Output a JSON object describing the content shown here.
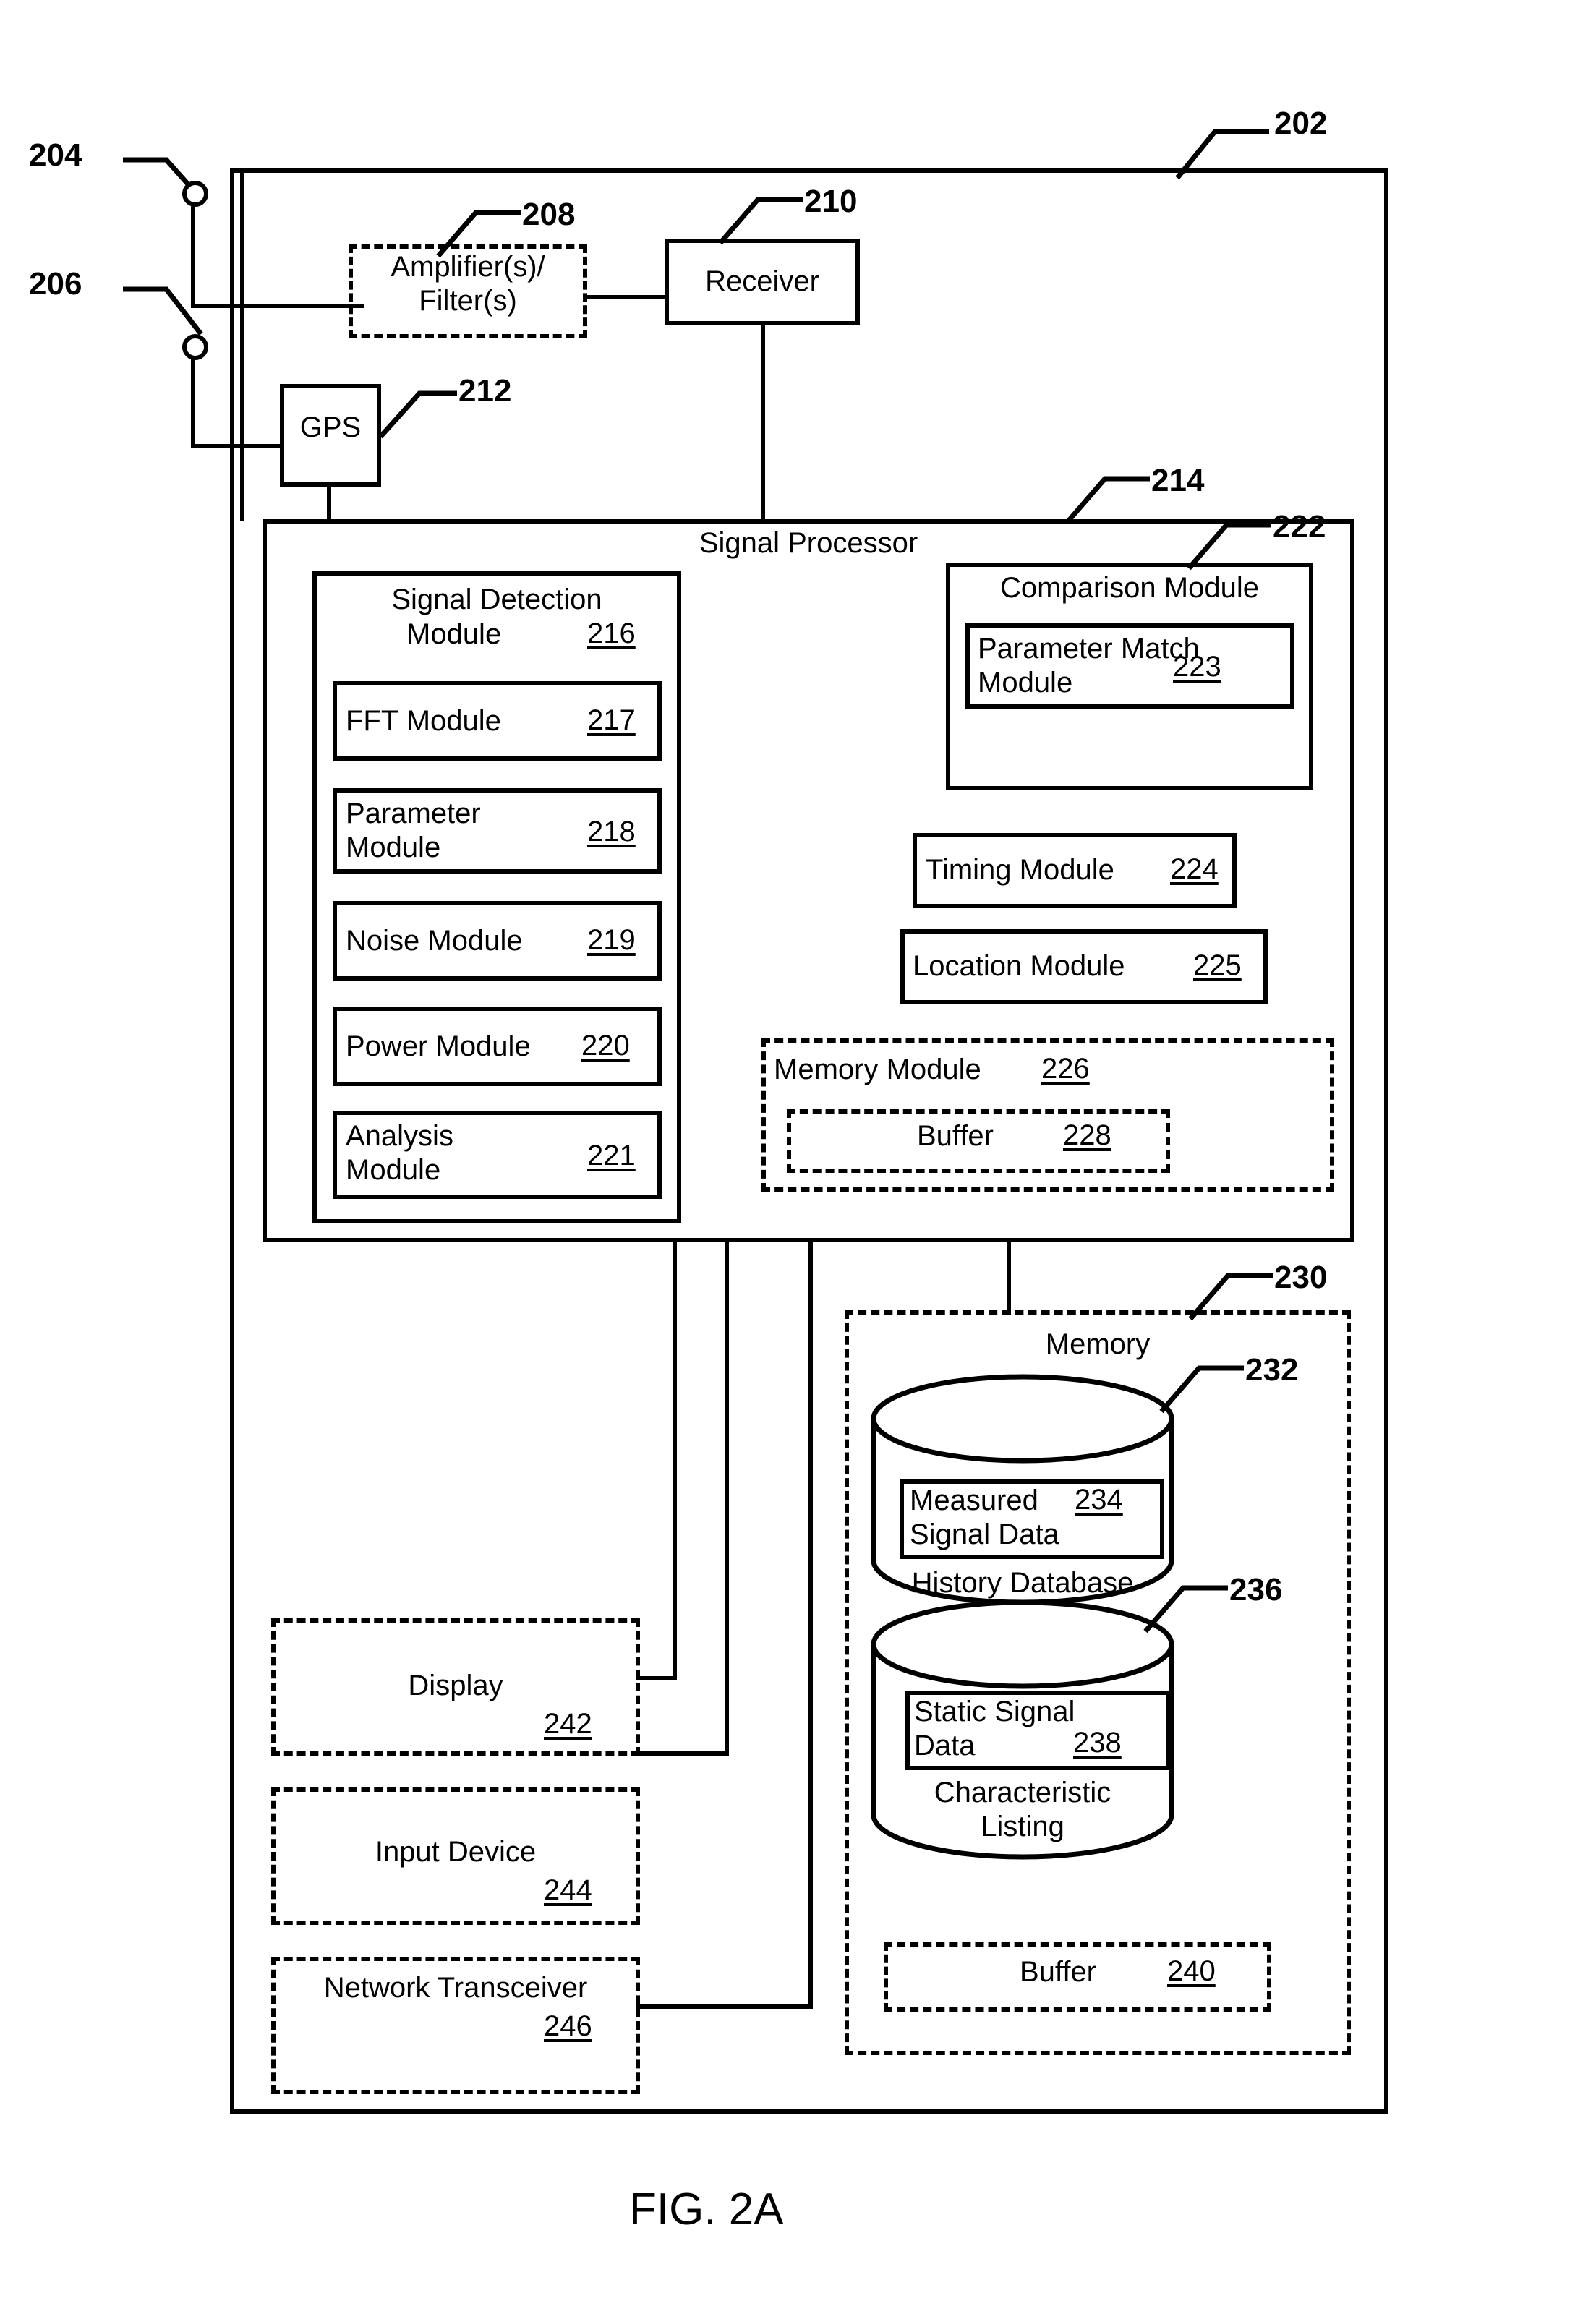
{
  "figure": {
    "caption": "FIG. 2A"
  },
  "callouts": {
    "system": "202",
    "antenna1": "204",
    "antenna2": "206",
    "amplifier_filter": "208",
    "receiver": "210",
    "gps": "212",
    "signal_processor": "214",
    "comparison_module": "222",
    "memory": "230",
    "history_database": "232",
    "static_signal_db": "236"
  },
  "blocks": {
    "amplifier_filter": {
      "line1": "Amplifier(s)/",
      "line2": "Filter(s)"
    },
    "receiver": {
      "label": "Receiver"
    },
    "gps": {
      "label": "GPS"
    },
    "signal_processor": {
      "label": "Signal Processor"
    },
    "signal_detection_module": {
      "line1": "Signal Detection",
      "line2": "Module",
      "ref": "216"
    },
    "fft_module": {
      "label": "FFT Module",
      "ref": "217"
    },
    "parameter_module": {
      "line1": "Parameter",
      "line2": "Module",
      "ref": "218"
    },
    "noise_module": {
      "label": "Noise Module",
      "ref": "219"
    },
    "power_module": {
      "label": "Power Module",
      "ref": "220"
    },
    "analysis_module": {
      "line1": "Analysis",
      "line2": "Module",
      "ref": "221"
    },
    "comparison_module": {
      "label": "Comparison Module"
    },
    "parameter_match_module": {
      "line1": "Parameter Match",
      "line2": "Module",
      "ref": "223"
    },
    "timing_module": {
      "label": "Timing Module",
      "ref": "224"
    },
    "location_module": {
      "label": "Location Module",
      "ref": "225"
    },
    "memory_module": {
      "label": "Memory Module",
      "ref": "226"
    },
    "memory_module_buffer": {
      "label": "Buffer",
      "ref": "228"
    },
    "memory": {
      "label": "Memory"
    },
    "history_database": {
      "label": "History Database"
    },
    "measured_signal_data": {
      "line1": "Measured",
      "line2": "Signal Data",
      "ref": "234"
    },
    "static_signal_characteristic_listing": {
      "line1": "Characteristic",
      "line2": "Listing"
    },
    "static_signal_data": {
      "line1": "Static Signal",
      "line2": "Data",
      "ref": "238"
    },
    "memory_buffer": {
      "label": "Buffer",
      "ref": "240"
    },
    "display": {
      "label": "Display",
      "ref": "242"
    },
    "input_device": {
      "label": "Input Device",
      "ref": "244"
    },
    "network_transceiver": {
      "label": "Network Transceiver",
      "ref": "246"
    }
  },
  "colors": {
    "ink": "#000000",
    "paper": "#ffffff"
  }
}
